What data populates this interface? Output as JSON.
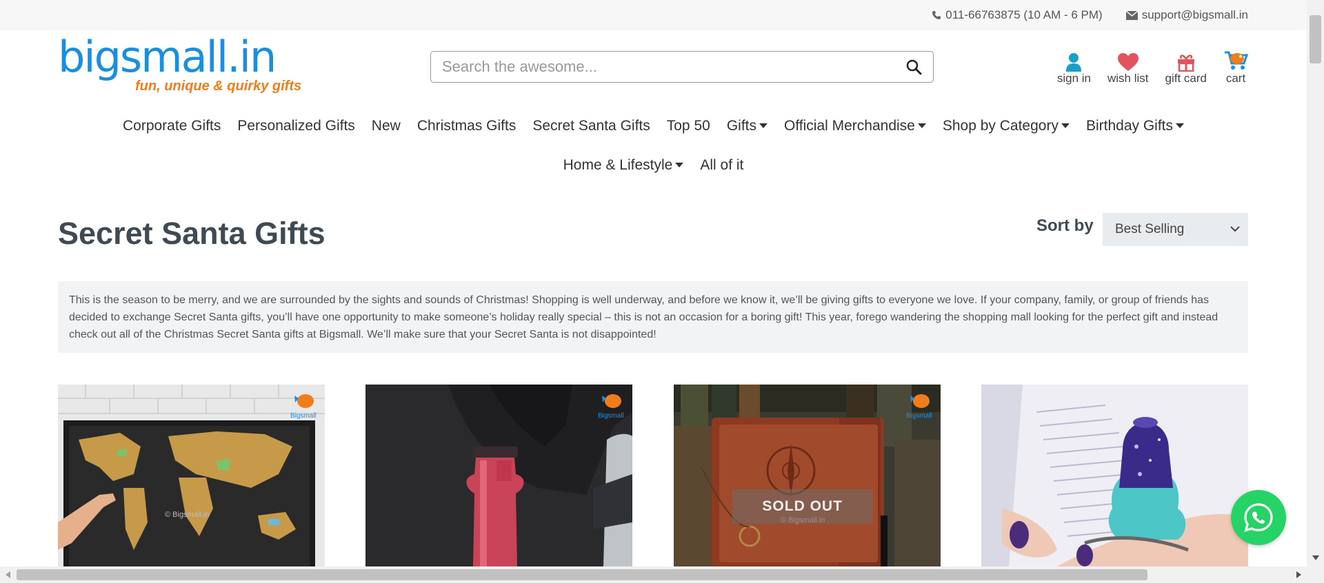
{
  "topbar": {
    "phone": "011-66763875 (10 AM - 6 PM)",
    "email": "support@bigsmall.in"
  },
  "logo": {
    "name": "bigsmall.in",
    "tagline": "fun, unique & quirky gifts"
  },
  "search": {
    "placeholder": "Search the awesome..."
  },
  "header_actions": [
    {
      "label": "sign in",
      "icon": "user-icon"
    },
    {
      "label": "wish list",
      "icon": "heart-icon"
    },
    {
      "label": "gift card",
      "icon": "gift-icon"
    },
    {
      "label": "cart",
      "icon": "cart-icon"
    }
  ],
  "nav": [
    {
      "label": "Corporate Gifts"
    },
    {
      "label": "Personalized Gifts"
    },
    {
      "label": "New"
    },
    {
      "label": "Christmas Gifts"
    },
    {
      "label": "Secret Santa Gifts"
    },
    {
      "label": "Top 50"
    },
    {
      "label": "Gifts"
    },
    {
      "label": "Official Merchandise"
    },
    {
      "label": "Shop by Category"
    },
    {
      "label": "Birthday Gifts"
    },
    {
      "label": "Home & Lifestyle"
    },
    {
      "label": "All of it"
    }
  ],
  "page": {
    "title": "Secret Santa Gifts",
    "sort_label": "Sort by",
    "sort_value": "Best Selling",
    "description": "This is the season to be merry, and we are surrounded by the sights and sounds of Christmas! Shopping is well underway, and before we know it, we’ll be giving gifts to everyone we love. If your company, family, or group of friends has decided to exchange Secret Santa gifts, you’ll have one opportunity to make someone’s holiday really special – this is not an occasion for a boring gift! This year, forego wandering the shopping mall looking for the perfect gift and instead check out all of the Christmas Secret Santa gifts at Bigsmall. We’ll make sure that your Secret Santa is not disappointed!"
  },
  "products": [
    {
      "image": "scratch-world-map",
      "watermark": "© Bigsmall.in",
      "sold_out": ""
    },
    {
      "image": "pink-bottle",
      "watermark": "",
      "sold_out": ""
    },
    {
      "image": "leather-journal",
      "watermark": "© Bigsmall.in",
      "sold_out": "SOLD OUT"
    },
    {
      "image": "glitter-ring-holder",
      "watermark": "",
      "sold_out": ""
    }
  ],
  "colors": {
    "brand_blue": "#1a8fe0",
    "brand_orange": "#f07d1a",
    "heart": "#e0535f",
    "user": "#1a9fc6",
    "whatsapp": "#25d366"
  }
}
